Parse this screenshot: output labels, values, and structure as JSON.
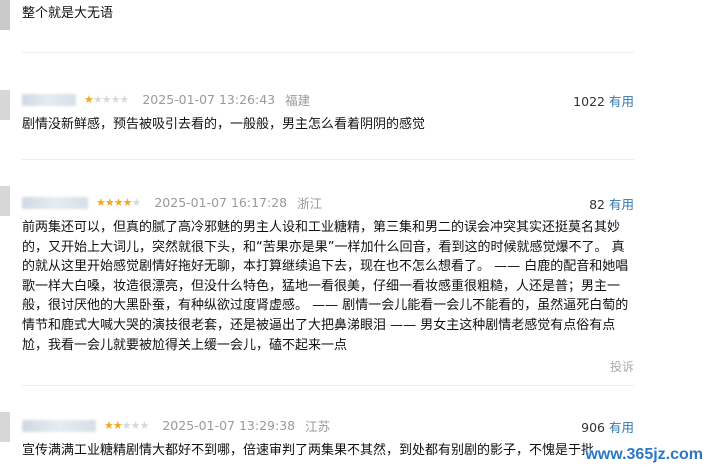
{
  "top_snippet": "整个就是大无语",
  "reviews": [
    {
      "rating": 1,
      "date": "2025-01-07 13:26:43",
      "location": "福建",
      "useful_count": "1022",
      "useful_label": "有用",
      "text": "剧情没新鲜感，预告被吸引去看的，一般般，男主怎么看着阴阴的感觉"
    },
    {
      "rating": 4,
      "date": "2025-01-07 16:17:28",
      "location": "浙江",
      "useful_count": "82",
      "useful_label": "有用",
      "text": "前两集还可以，但真的腻了高冷邪魅的男主人设和工业糖精，第三集和男二的误会冲突其实还挺莫名其妙的，又开始上大词儿，突然就很下头，和“苦果亦是果”一样加什么回音，看到这的时候就感觉爆不了。 真的就从这里开始感觉剧情好拖好无聊，本打算继续追下去，现在也不怎么想看了。 —— 白鹿的配音和她唱歌一样大白嗓，妆造很漂亮，但没什么特色，猛地一看很美，仔细一看妆感重很粗糙，人还是普；男主一般，很讨厌他的大黑卧蚕，有种纵欲过度肾虚感。 —— 剧情一会儿能看一会儿不能看的，虽然逼死白萄的情节和鹿式大喊大哭的演技很老套，还是被逼出了大把鼻涕眼泪 —— 男女主这种剧情老感觉有点俗有点尬，我看一会儿就要被尬得关上缓一会儿，磕不起来一点",
      "report_label": "投诉"
    },
    {
      "rating": 2,
      "date": "2025-01-07 13:29:38",
      "location": "江苏",
      "useful_count": "906",
      "useful_label": "有用",
      "text": "宣传满满工业糖精剧情大都好不到哪，倍速审判了两集果不其然，到处都有别剧的影子，不愧是于批..."
    }
  ],
  "watermark": "www.365jz.com",
  "colors": {
    "star": "#f5a623",
    "link": "#3377aa",
    "meta": "#9a9a9a"
  }
}
